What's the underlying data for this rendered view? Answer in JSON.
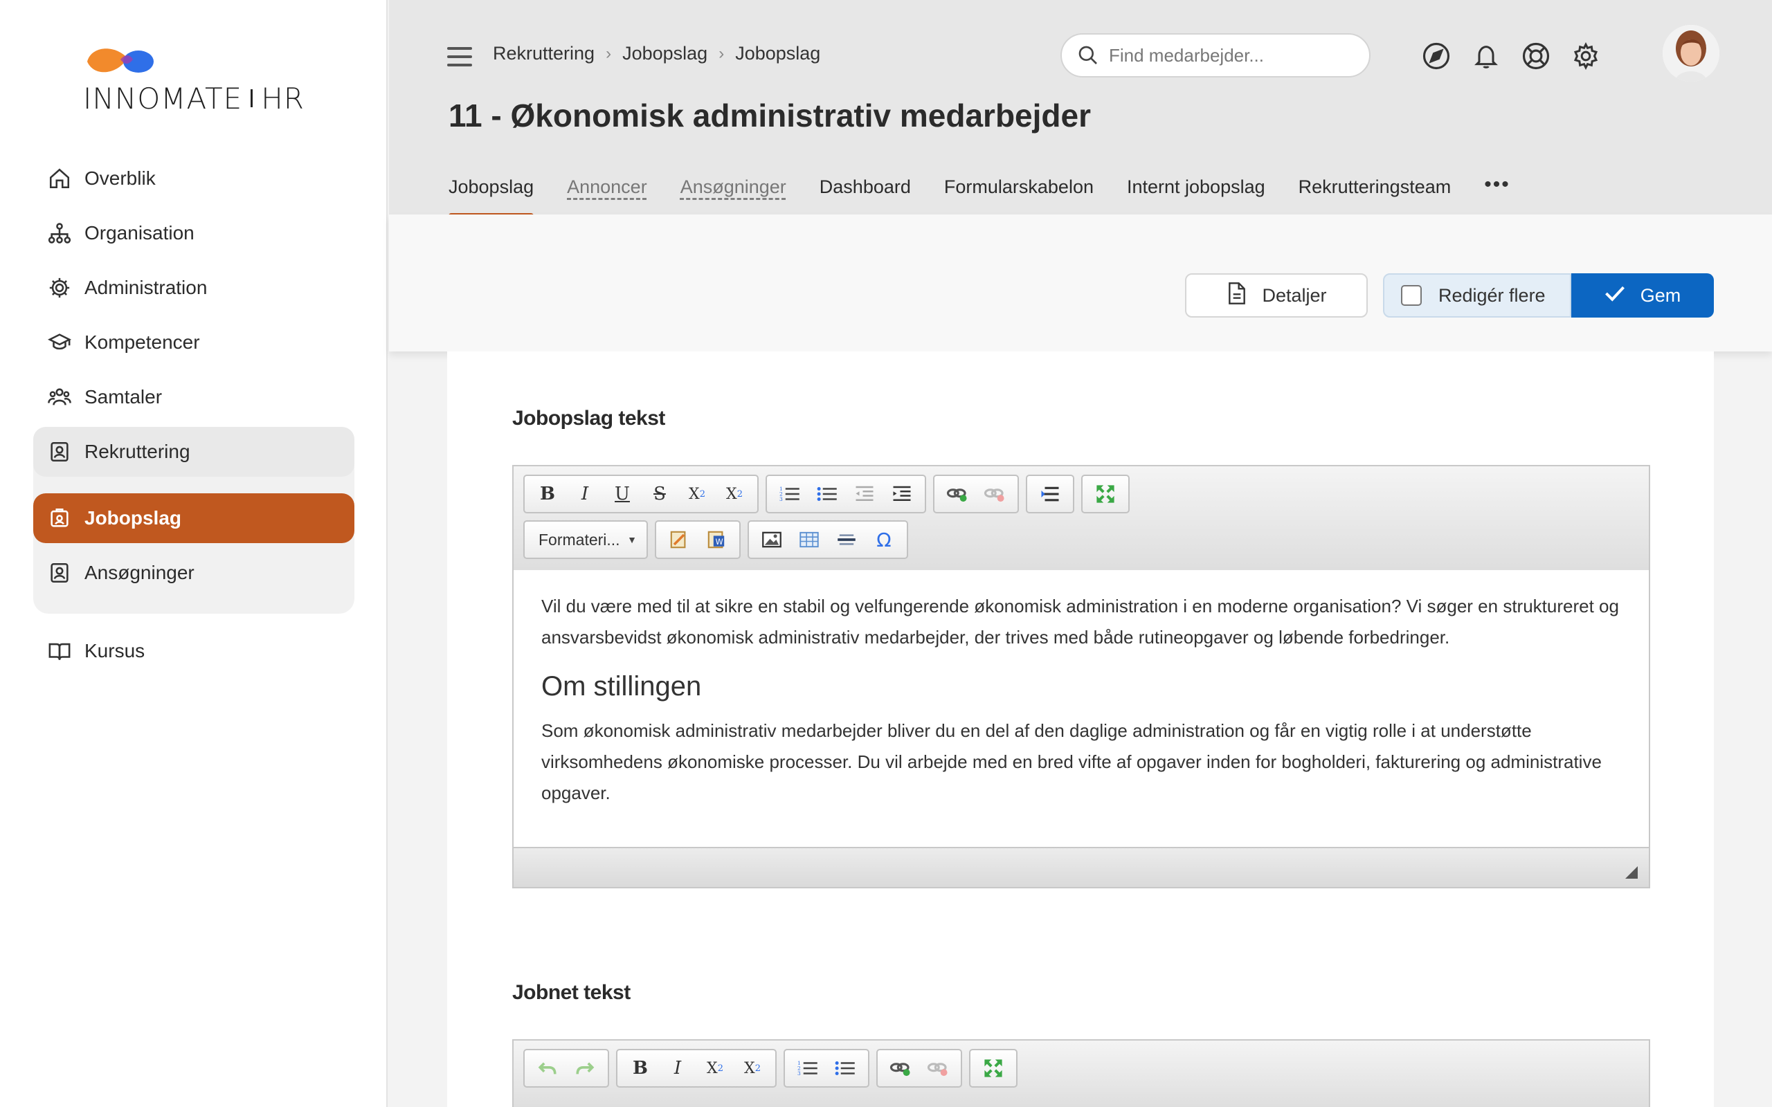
{
  "brand": {
    "name_left": "INNOMATE",
    "name_right": "HR",
    "colors": {
      "orange": "#f28a2c",
      "blue": "#2f6fe8",
      "accent": "#c0581f",
      "primary": "#0c66c2"
    }
  },
  "sidebar": {
    "items": [
      {
        "label": "Overblik",
        "icon": "home-icon"
      },
      {
        "label": "Organisation",
        "icon": "org-chart-icon"
      },
      {
        "label": "Administration",
        "icon": "gear-icon"
      },
      {
        "label": "Kompetencer",
        "icon": "graduation-cap-icon"
      },
      {
        "label": "Samtaler",
        "icon": "people-icon"
      }
    ],
    "group": {
      "head": {
        "label": "Rekruttering",
        "icon": "id-badge-icon"
      },
      "children": [
        {
          "label": "Jobopslag",
          "icon": "job-post-icon",
          "active": true
        },
        {
          "label": "Ansøgninger",
          "icon": "id-badge-icon"
        }
      ]
    },
    "after": [
      {
        "label": "Kursus",
        "icon": "book-icon"
      }
    ]
  },
  "header": {
    "breadcrumb": [
      "Rekruttering",
      "Jobopslag",
      "Jobopslag"
    ],
    "title": "11 - Økonomisk administrativ medarbejder",
    "search_placeholder": "Find medarbejder...",
    "icons": [
      "navigate-icon",
      "bell-icon",
      "help-lifebuoy-icon",
      "settings-gear-icon"
    ],
    "tabs": [
      {
        "label": "Jobopslag",
        "active": true
      },
      {
        "label": "Annoncer",
        "dashed": true
      },
      {
        "label": "Ansøgninger",
        "dashed": true
      },
      {
        "label": "Dashboard"
      },
      {
        "label": "Formularskabelon"
      },
      {
        "label": "Internt jobopslag"
      },
      {
        "label": "Rekrutteringsteam"
      }
    ],
    "more": "•••"
  },
  "actions": {
    "details": "Detaljer",
    "edit_multiple": "Redigér flere",
    "save": "Gem"
  },
  "section1": {
    "title": "Jobopslag tekst",
    "format_select": "Formateri...",
    "paragraph1": "Vil du være med til at sikre en stabil og velfungerende økonomisk administration i en moderne organisation? Vi søger en struktureret og ansvarsbevidst økonomisk administrativ medarbejder, der trives med både rutineopgaver og løbende forbedringer.",
    "heading": "Om stillingen",
    "paragraph2": "Som økonomisk administrativ medarbejder bliver du en del af den daglige administration og får en vigtig rolle i at understøtte virksomhedens økonomiske processer. Du vil arbejde med en bred vifte af opgaver inden for bogholderi, fakturering og administrative opgaver."
  },
  "section2": {
    "title": "Jobnet tekst"
  }
}
